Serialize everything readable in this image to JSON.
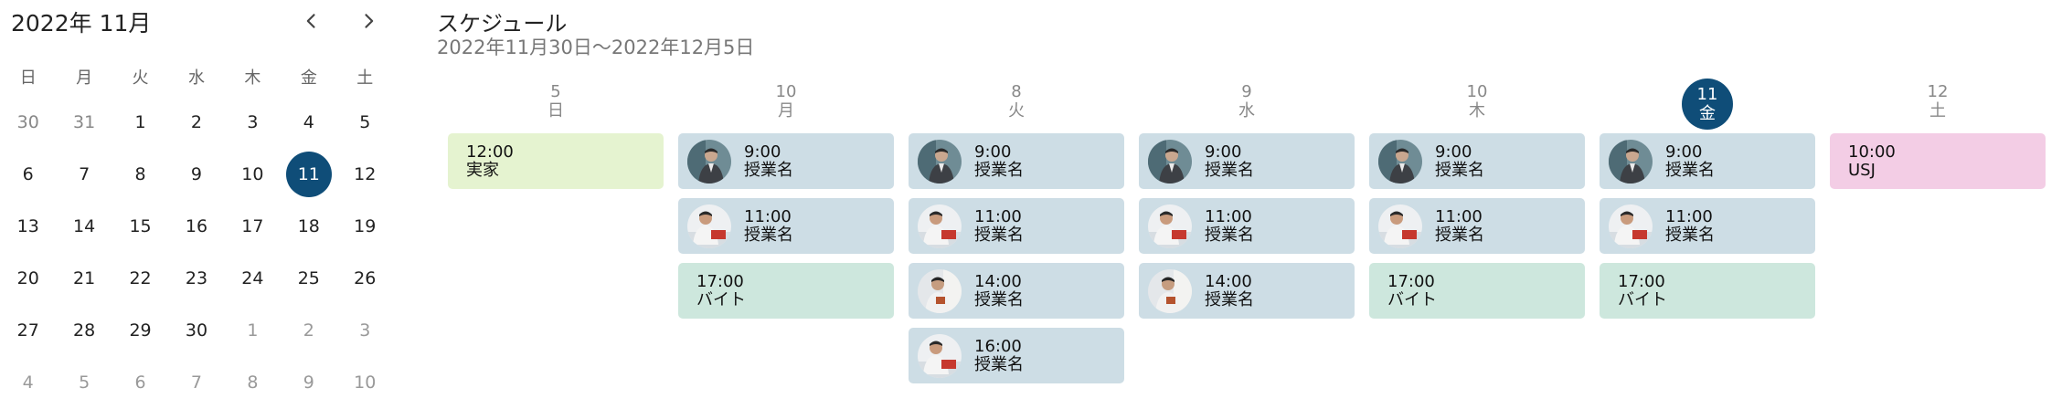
{
  "calendar": {
    "title": "2022年 11月",
    "weekdays": [
      "日",
      "月",
      "火",
      "水",
      "木",
      "金",
      "土"
    ],
    "weeks": [
      [
        {
          "d": "30",
          "m": "prev"
        },
        {
          "d": "31",
          "m": "prev"
        },
        {
          "d": "1",
          "m": "cur"
        },
        {
          "d": "2",
          "m": "cur"
        },
        {
          "d": "3",
          "m": "cur"
        },
        {
          "d": "4",
          "m": "cur"
        },
        {
          "d": "5",
          "m": "cur"
        }
      ],
      [
        {
          "d": "6",
          "m": "cur"
        },
        {
          "d": "7",
          "m": "cur"
        },
        {
          "d": "8",
          "m": "cur"
        },
        {
          "d": "9",
          "m": "cur"
        },
        {
          "d": "10",
          "m": "cur"
        },
        {
          "d": "11",
          "m": "cur",
          "selected": true
        },
        {
          "d": "12",
          "m": "cur"
        }
      ],
      [
        {
          "d": "13",
          "m": "cur"
        },
        {
          "d": "14",
          "m": "cur"
        },
        {
          "d": "15",
          "m": "cur"
        },
        {
          "d": "16",
          "m": "cur"
        },
        {
          "d": "17",
          "m": "cur"
        },
        {
          "d": "18",
          "m": "cur"
        },
        {
          "d": "19",
          "m": "cur"
        }
      ],
      [
        {
          "d": "20",
          "m": "cur"
        },
        {
          "d": "21",
          "m": "cur"
        },
        {
          "d": "22",
          "m": "cur"
        },
        {
          "d": "23",
          "m": "cur"
        },
        {
          "d": "24",
          "m": "cur"
        },
        {
          "d": "25",
          "m": "cur"
        },
        {
          "d": "26",
          "m": "cur"
        }
      ],
      [
        {
          "d": "27",
          "m": "cur"
        },
        {
          "d": "28",
          "m": "cur"
        },
        {
          "d": "29",
          "m": "cur"
        },
        {
          "d": "30",
          "m": "cur"
        },
        {
          "d": "1",
          "m": "next"
        },
        {
          "d": "2",
          "m": "next"
        },
        {
          "d": "3",
          "m": "next"
        }
      ],
      [
        {
          "d": "4",
          "m": "next"
        },
        {
          "d": "5",
          "m": "next"
        },
        {
          "d": "6",
          "m": "next"
        },
        {
          "d": "7",
          "m": "next"
        },
        {
          "d": "8",
          "m": "next"
        },
        {
          "d": "9",
          "m": "next"
        },
        {
          "d": "10",
          "m": "next"
        }
      ]
    ],
    "prev_icon": "chevron-left-icon",
    "next_icon": "chevron-right-icon"
  },
  "schedule": {
    "title": "スケジュール",
    "range": "2022年11月30日〜2022年12月5日",
    "colors": {
      "lesson": "#cddde5",
      "home": "#e5f3d0",
      "job": "#cde7dd",
      "usj": "#f3cde5",
      "accent": "#0f4d78"
    },
    "days": [
      {
        "date": "5",
        "weekday": "日",
        "active": false,
        "events": [
          {
            "time": "12:00",
            "name": "実家",
            "kind": "home",
            "avatar": null
          }
        ]
      },
      {
        "date": "10",
        "weekday": "月",
        "active": false,
        "events": [
          {
            "time": "9:00",
            "name": "授業名",
            "kind": "lesson",
            "avatar": "teacher-a"
          },
          {
            "time": "11:00",
            "name": "授業名",
            "kind": "lesson",
            "avatar": "teacher-b"
          },
          {
            "time": "17:00",
            "name": "バイト",
            "kind": "job",
            "avatar": null
          }
        ]
      },
      {
        "date": "8",
        "weekday": "火",
        "active": false,
        "events": [
          {
            "time": "9:00",
            "name": "授業名",
            "kind": "lesson",
            "avatar": "teacher-a"
          },
          {
            "time": "11:00",
            "name": "授業名",
            "kind": "lesson",
            "avatar": "teacher-b"
          },
          {
            "time": "14:00",
            "name": "授業名",
            "kind": "lesson",
            "avatar": "teacher-c"
          },
          {
            "time": "16:00",
            "name": "授業名",
            "kind": "lesson",
            "avatar": "teacher-b"
          }
        ]
      },
      {
        "date": "9",
        "weekday": "水",
        "active": false,
        "events": [
          {
            "time": "9:00",
            "name": "授業名",
            "kind": "lesson",
            "avatar": "teacher-a"
          },
          {
            "time": "11:00",
            "name": "授業名",
            "kind": "lesson",
            "avatar": "teacher-b"
          },
          {
            "time": "14:00",
            "name": "授業名",
            "kind": "lesson",
            "avatar": "teacher-c"
          }
        ]
      },
      {
        "date": "10",
        "weekday": "木",
        "active": false,
        "events": [
          {
            "time": "9:00",
            "name": "授業名",
            "kind": "lesson",
            "avatar": "teacher-a"
          },
          {
            "time": "11:00",
            "name": "授業名",
            "kind": "lesson",
            "avatar": "teacher-b"
          },
          {
            "time": "17:00",
            "name": "バイト",
            "kind": "job",
            "avatar": null
          }
        ]
      },
      {
        "date": "11",
        "weekday": "金",
        "active": true,
        "events": [
          {
            "time": "9:00",
            "name": "授業名",
            "kind": "lesson",
            "avatar": "teacher-a"
          },
          {
            "time": "11:00",
            "name": "授業名",
            "kind": "lesson",
            "avatar": "teacher-b"
          },
          {
            "time": "17:00",
            "name": "バイト",
            "kind": "job",
            "avatar": null
          }
        ]
      },
      {
        "date": "12",
        "weekday": "土",
        "active": false,
        "events": [
          {
            "time": "10:00",
            "name": "USJ",
            "kind": "usj",
            "avatar": null
          }
        ]
      }
    ]
  }
}
